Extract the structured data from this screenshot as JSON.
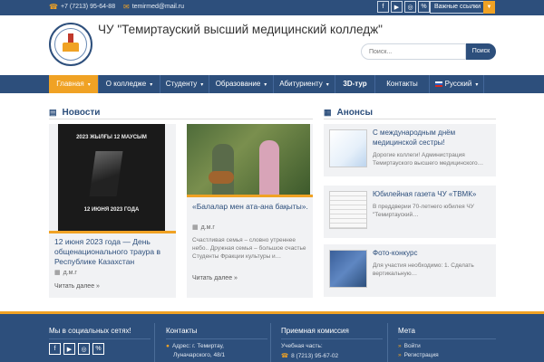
{
  "topbar": {
    "phone": "+7 (7213) 95-64-88",
    "email": "temirmed@mail.ru",
    "social": [
      {
        "icon": "facebook-icon",
        "glyph": "f"
      },
      {
        "icon": "youtube-icon",
        "glyph": "▶"
      },
      {
        "icon": "instagram-icon",
        "glyph": "◎"
      },
      {
        "icon": "link-icon",
        "glyph": "%"
      }
    ],
    "links_dropdown": "Важные ссылки"
  },
  "header": {
    "title": "ЧУ \"Темиртауский высший медицинский колледж\"",
    "search_placeholder": "Поиск...",
    "search_button": "Поиск"
  },
  "nav": {
    "items": [
      {
        "label": "Главная",
        "dropdown": true,
        "active": true
      },
      {
        "label": "О колледже",
        "dropdown": true
      },
      {
        "label": "Студенту",
        "dropdown": true
      },
      {
        "label": "Образование",
        "dropdown": true
      },
      {
        "label": "Абитуриенту",
        "dropdown": true
      },
      {
        "label": "3D-тур",
        "dropdown": false
      },
      {
        "label": "Контакты",
        "dropdown": false
      },
      {
        "label": "Русский",
        "dropdown": true
      }
    ]
  },
  "news": {
    "title": "Новости",
    "cards": [
      {
        "image_text_top": "2023 ЖЫЛҒЫ 12 МАУСЫМ",
        "image_text_bottom": "12 ИЮНЯ 2023 ГОДА",
        "title": "12 июня 2023 года — День общенационального траура в Республике Казахстан",
        "author": "д.м.г",
        "read_more": "Читать далее »"
      },
      {
        "title": "«Балалар мен ата-ана бақыты».",
        "author": "д.м.г",
        "excerpt": "Счастливая семья – словно утреннее небо.. Дружная семья – большое счастье Студенты Фракции культуры и…",
        "read_more": "Читать далее »"
      }
    ]
  },
  "announces": {
    "title": "Анонсы",
    "items": [
      {
        "title": "С международным днём медицинской сестры!",
        "excerpt": "Дорогие коллеги! Администрация Темиртауского высшего медицинского…"
      },
      {
        "title": "Юбилейная газета ЧУ «ТВМК»",
        "excerpt": "В преддверии 70-летнего юбилея ЧУ \"Темиртауский…"
      },
      {
        "title": "Фото-конкурс",
        "excerpt": "Для участия необходимо: 1. Сделать вертикальную…"
      }
    ]
  },
  "footer": {
    "social_title": "Мы в социальных сетях!",
    "contacts_title": "Контакты",
    "address_line1": "Адрес: г. Темиртау,",
    "address_line2": "Луначарского, 48/1",
    "admission_title": "Приемная комиссия",
    "admission_label": "Учебная часть:",
    "admission_phone": "8 (7213) 95-67-02",
    "meta_title": "Мета",
    "meta_links": [
      "Войти",
      "Регистрация"
    ]
  },
  "colors": {
    "primary": "#2d4f7c",
    "accent": "#f0a224"
  }
}
